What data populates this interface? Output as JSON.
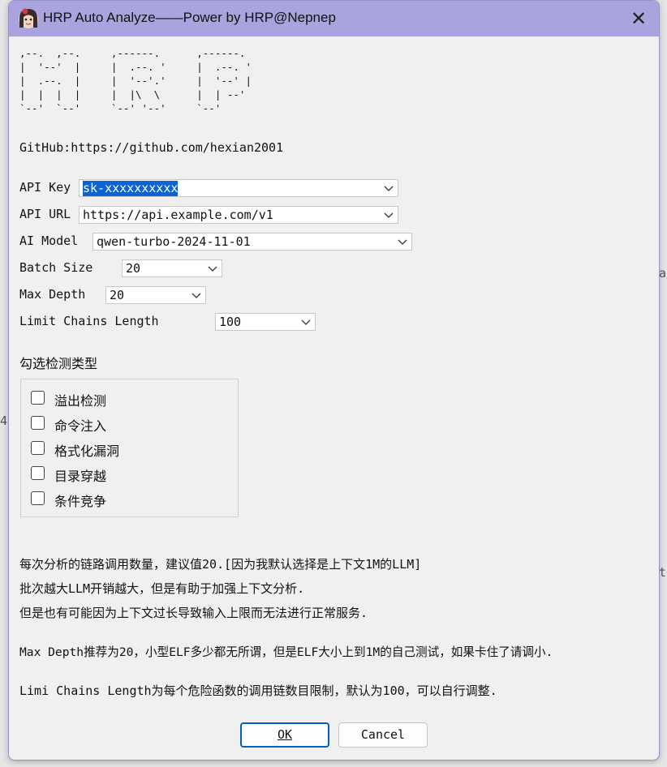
{
  "window": {
    "title": "HRP Auto Analyze——Power by HRP@Nepnep",
    "close_symbol": "✕"
  },
  "ascii_art": ",--.  ,--.     ,------.      ,------.\n|  '--'  |     |  .--. '     |  .--. '\n|  .--.  |     |  '--'.'     |  '--' |\n|  |  |  |     |  |\\  \\      |  | --'\n`--'  `--'     `--' '--'     `--'",
  "github": "GitHub:https://github.com/hexian2001",
  "fields": {
    "api_key": {
      "label": "API Key",
      "value": "sk-xxxxxxxxxx"
    },
    "api_url": {
      "label": "API URL",
      "value": "https://api.example.com/v1"
    },
    "ai_model": {
      "label": "AI Model",
      "value": "qwen-turbo-2024-11-01"
    },
    "batch_size": {
      "label": "Batch Size",
      "value": "20"
    },
    "max_depth": {
      "label": "Max Depth",
      "value": "20"
    },
    "limit_chains": {
      "label": "Limit Chains Length",
      "value": "100"
    }
  },
  "detect": {
    "title": "勾选检测类型",
    "items": [
      {
        "label": "溢出检测",
        "checked": false
      },
      {
        "label": "命令注入",
        "checked": false
      },
      {
        "label": "格式化漏洞",
        "checked": false
      },
      {
        "label": "目录穿越",
        "checked": false
      },
      {
        "label": "条件竞争",
        "checked": false
      }
    ]
  },
  "notes": {
    "line1": "每次分析的链路调用数量，建议值20.[因为我默认选择是上下文1M的LLM]",
    "line2": "批次越大LLM开销越大，但是有助于加强上下文分析.",
    "line3": "但是也有可能因为上下文过长导致输入上限而无法进行正常服务.",
    "line4": "Max Depth推荐为20，小型ELF多少都无所谓，但是ELF大小上到1M的自己测试，如果卡住了请调小.",
    "line5": "Limi Chains Length为每个危险函数的调用链数目限制，默认为100，可以自行调整."
  },
  "buttons": {
    "ok": "OK",
    "cancel": "Cancel"
  },
  "colors": {
    "titlebar": "#a9a4de",
    "selection": "#0a64d6",
    "default_button_border": "#0a5cc0"
  }
}
